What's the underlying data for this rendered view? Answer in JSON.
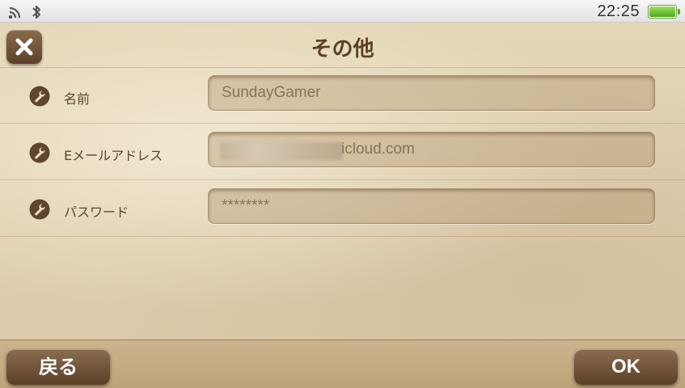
{
  "status_bar": {
    "clock": "22:25",
    "icons": [
      "wifi-icon",
      "bluetooth-icon",
      "battery-icon"
    ],
    "battery_level": 0.95
  },
  "header": {
    "title": "その他",
    "close_icon": "close-icon"
  },
  "form": {
    "rows": [
      {
        "icon": "wrench-icon",
        "label": "名前",
        "value": "SundayGamer"
      },
      {
        "icon": "wrench-icon",
        "label": "Eメールアドレス",
        "value_visible": "icloud.com"
      },
      {
        "icon": "wrench-icon",
        "label": "パスワード",
        "value": "********"
      }
    ]
  },
  "footer": {
    "back_label": "戻る",
    "ok_label": "OK"
  },
  "colors": {
    "parchment": "#dccbaa",
    "button_brown": "#5a3f28",
    "text_brown": "#5b4531"
  }
}
